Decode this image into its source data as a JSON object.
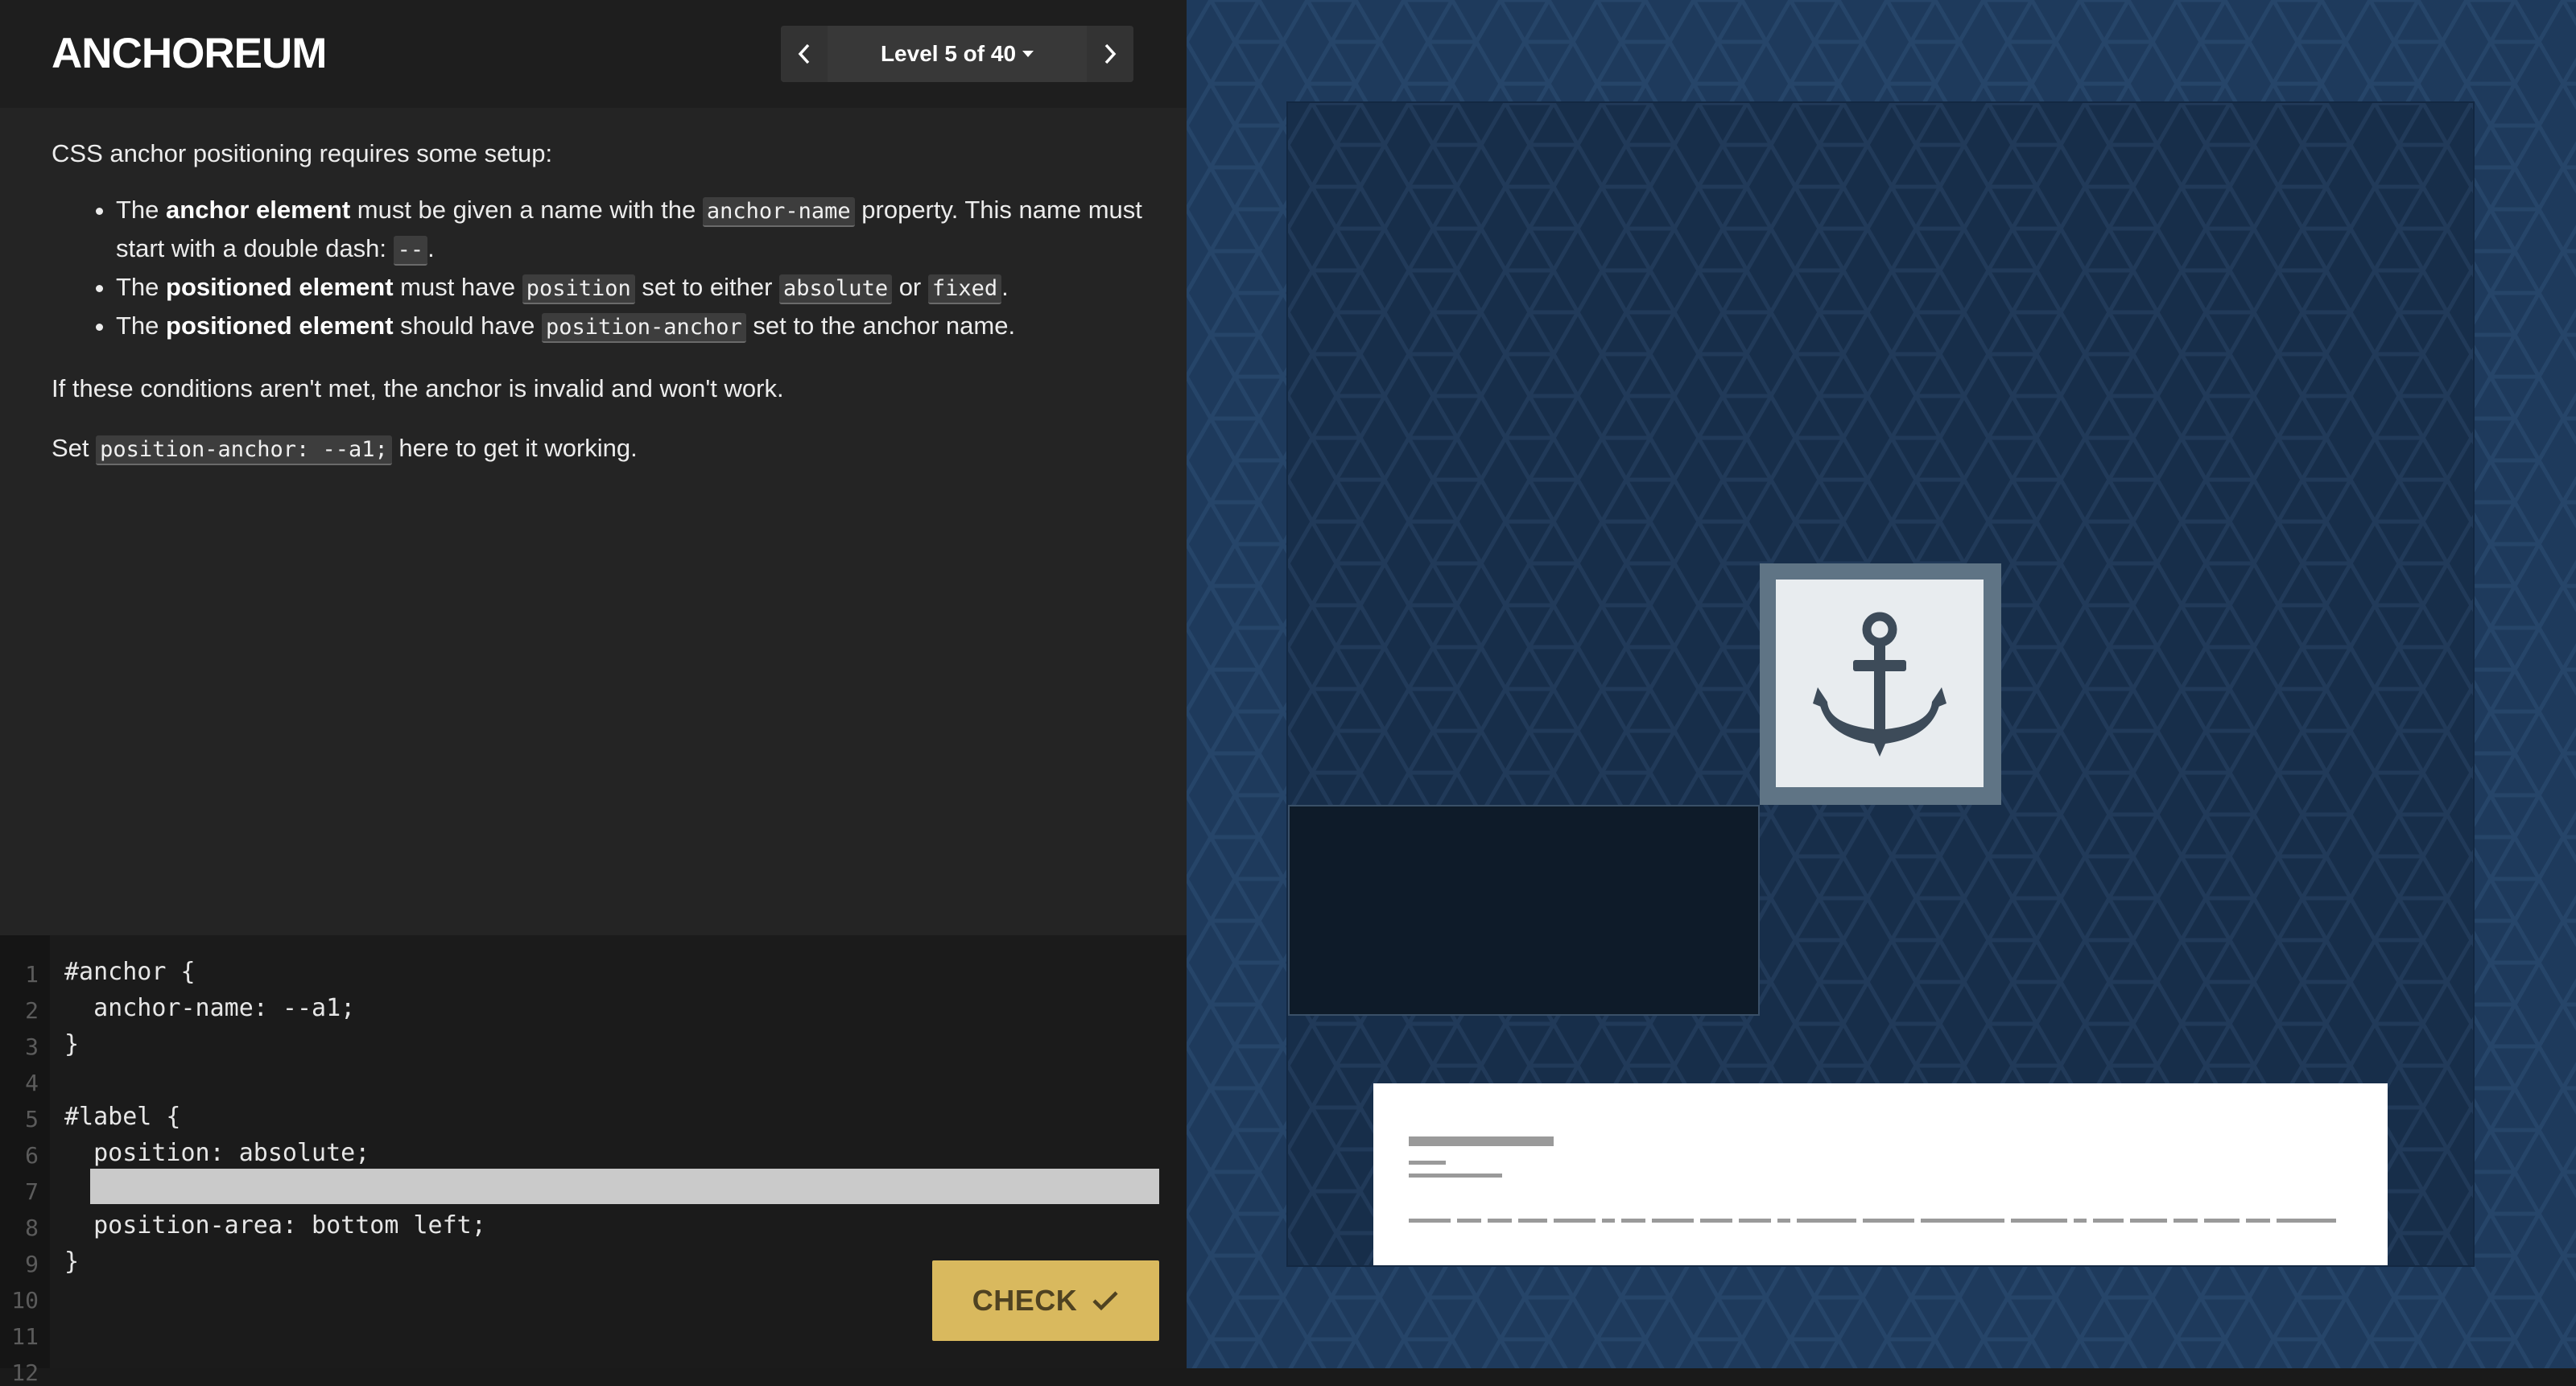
{
  "app": {
    "logo": "ANCHOREUM"
  },
  "level_nav": {
    "prev_icon": "chevron-left-icon",
    "level_label": "Level 5 of 40",
    "next_icon": "chevron-right-icon"
  },
  "instructions": {
    "intro": "CSS anchor positioning requires some setup:",
    "bullets": [
      {
        "pre": "The ",
        "bold": "anchor element",
        "mid": " must be given a name with the ",
        "code": "anchor-name",
        "post": " property. This name must start with a double dash: ",
        "code2": "--",
        "end": "."
      },
      {
        "pre": "The ",
        "bold": "positioned element",
        "mid": " must have ",
        "code": "position",
        "post": " set to either ",
        "code2": "absolute",
        "or": " or ",
        "code3": "fixed",
        "end": "."
      },
      {
        "pre": "The ",
        "bold": "positioned element",
        "mid": " should have ",
        "code": "position-anchor",
        "post": " set to the anchor name."
      }
    ],
    "conditions": "If these conditions aren't met, the anchor is invalid and won't work.",
    "set_pre": "Set ",
    "set_code": "position-anchor: --a1;",
    "set_post": " here to get it working."
  },
  "editor": {
    "line_numbers": [
      "1",
      "2",
      "3",
      "4",
      "5",
      "6",
      "7",
      "8",
      "9",
      "10",
      "11",
      "12"
    ],
    "lines": [
      "#anchor {",
      "  anchor-name: --a1;",
      "}",
      "",
      "#label {",
      "  position: absolute;",
      "",
      "  position-area: bottom left;",
      "}"
    ],
    "input_value": "",
    "check_label": "CHECK",
    "check_icon": "checkmark-icon"
  },
  "preview": {
    "anchor_icon": "anchor-icon",
    "label_icon": "placeholder-text-lines"
  }
}
